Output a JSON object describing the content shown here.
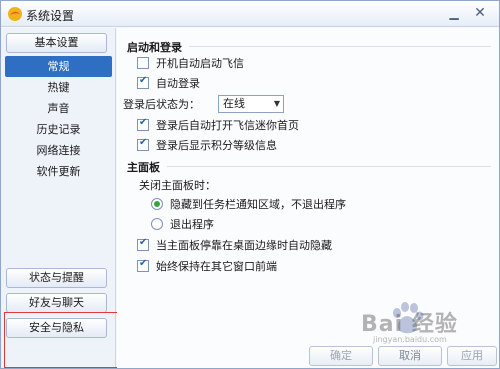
{
  "window": {
    "title": "系统设置",
    "minimize_icon": "minimize-icon",
    "close_icon": "close-icon"
  },
  "sidebar": {
    "top_category": "基本设置",
    "items": [
      {
        "label": "常规",
        "active": true
      },
      {
        "label": "热键",
        "active": false
      },
      {
        "label": "声音",
        "active": false
      },
      {
        "label": "历史记录",
        "active": false
      },
      {
        "label": "网络连接",
        "active": false
      },
      {
        "label": "软件更新",
        "active": false
      }
    ],
    "bottom_categories": [
      "状态与提醒",
      "好友与聊天",
      "安全与隐私"
    ]
  },
  "sections": {
    "startup": {
      "title": "启动和登录",
      "auto_start": {
        "label": "开机自动启动飞信",
        "checked": false
      },
      "auto_login": {
        "label": "自动登录",
        "checked": true
      },
      "login_status_label": "登录后状态为：",
      "login_status_value": "在线",
      "open_homepage": {
        "label": "登录后自动打开飞信迷你首页",
        "checked": true
      },
      "show_level": {
        "label": "登录后显示积分等级信息",
        "checked": true
      }
    },
    "main_panel": {
      "title": "主面板",
      "close_label": "关闭主面板时：",
      "hide_to_tray": {
        "label": "隐藏到任务栏通知区域，不退出程序",
        "checked": true
      },
      "exit_program": {
        "label": "退出程序",
        "checked": false
      },
      "auto_hide": {
        "label": "当主面板停靠在桌面边缘时自动隐藏",
        "checked": true
      },
      "always_on_top": {
        "label": "始终保持在其它窗口前端",
        "checked": true
      }
    }
  },
  "footer": {
    "ok": "确定",
    "cancel": "取消",
    "apply": "应用"
  },
  "watermark": {
    "text": "Bai 经验",
    "sub": "jingyan.baidu.com"
  }
}
